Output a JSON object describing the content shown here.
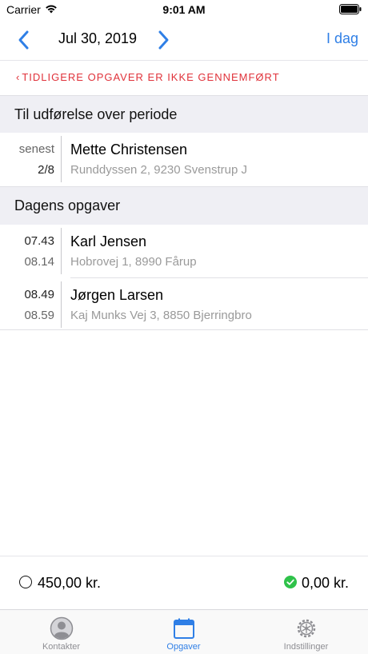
{
  "status_bar": {
    "carrier": "Carrier",
    "time": "9:01 AM",
    "icons": [
      "wifi-icon",
      "battery-icon"
    ]
  },
  "nav": {
    "date": "Jul 30, 2019",
    "today_label": "I dag",
    "accent": "#2f7fe6",
    "icons": [
      "chevron-left-icon",
      "chevron-right-icon"
    ]
  },
  "warning": {
    "text": "TIDLIGERE OPGAVER ER IKKE GENNEMFØRT",
    "color": "#e0323a"
  },
  "sections": {
    "period": {
      "title": "Til udførelse over periode",
      "tasks": [
        {
          "time_top": "senest",
          "time_bottom": "2/8",
          "name": "Mette Christensen",
          "address": "Runddyssen 2, 9230 Svenstrup J"
        }
      ]
    },
    "today": {
      "title": "Dagens opgaver",
      "tasks": [
        {
          "time_top": "07.43",
          "time_bottom": "08.14",
          "name": "Karl Jensen",
          "address": "Hobrovej 1, 8990 Fårup"
        },
        {
          "time_top": "08.49",
          "time_bottom": "08.59",
          "name": "Jørgen Larsen",
          "address": "Kaj Munks Vej 3, 8850 Bjerringbro"
        }
      ]
    }
  },
  "summary": {
    "pending_amount": "450,00 kr.",
    "completed_amount": "0,00 kr.",
    "completed_color": "#2fc24a"
  },
  "tabs": [
    {
      "label": "Kontakter",
      "icon": "contacts-icon",
      "active": false
    },
    {
      "label": "Opgaver",
      "icon": "calendar-icon",
      "active": true
    },
    {
      "label": "Indstillinger",
      "icon": "gear-icon",
      "active": false
    }
  ]
}
